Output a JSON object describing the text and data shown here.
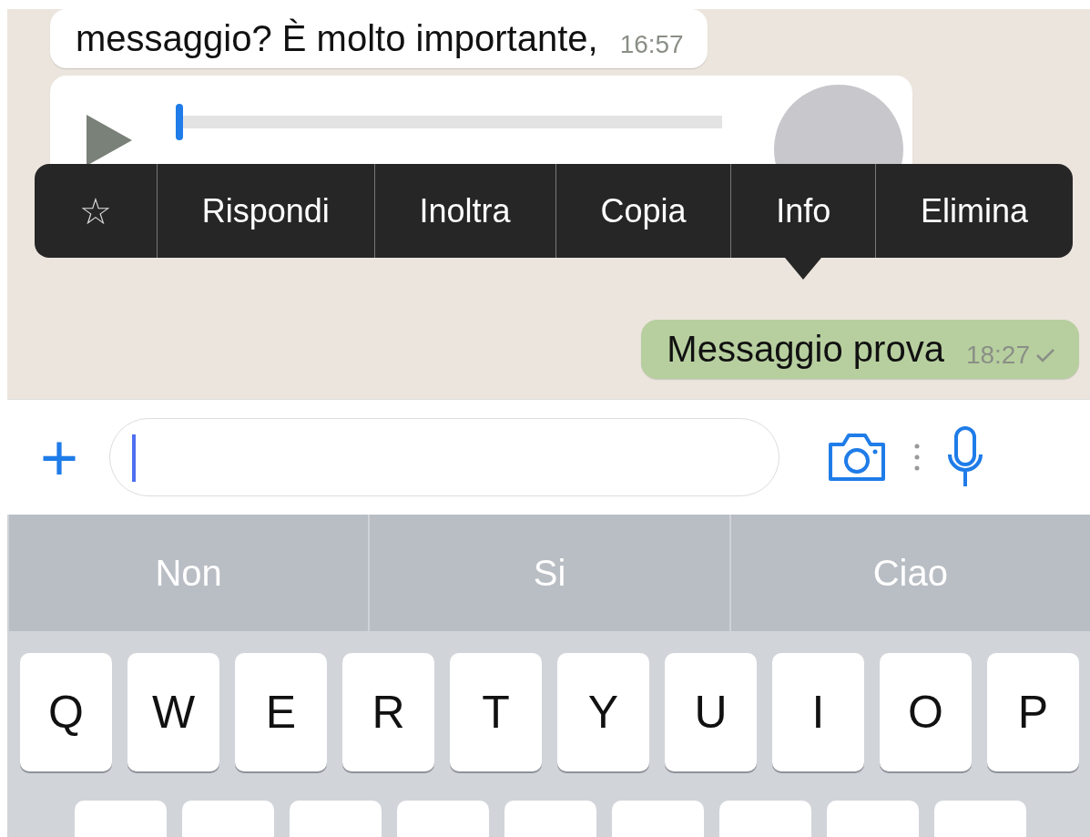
{
  "messages": [
    {
      "kind": "text",
      "outgoing": false,
      "text": "messaggio? È molto importante,",
      "time": "16:57"
    },
    {
      "kind": "audio",
      "outgoing": false,
      "level": 0
    },
    {
      "kind": "text",
      "outgoing": true,
      "text": "Messaggio prova",
      "time": "18:27",
      "sent": true
    }
  ],
  "context_menu": {
    "items": [
      {
        "kind": "icon",
        "label": "☆",
        "pointer": false
      },
      {
        "kind": "text",
        "label": "Rispondi",
        "pointer": false
      },
      {
        "kind": "text",
        "label": "Inoltra",
        "pointer": false
      },
      {
        "kind": "text",
        "label": "Copia",
        "pointer": false
      },
      {
        "kind": "text",
        "label": "Info",
        "pointer": true
      },
      {
        "kind": "text",
        "label": "Elimina",
        "pointer": false
      }
    ]
  },
  "input_bar": {
    "plus": "+"
  },
  "suggestions": [
    "Non",
    "Si",
    "Ciao"
  ],
  "keyboard": {
    "rows": [
      [
        "Q",
        "W",
        "E",
        "R",
        "T",
        "Y",
        "U",
        "I",
        "O",
        "P"
      ],
      [
        "",
        "",
        "",
        "",
        "",
        "",
        "",
        "",
        ""
      ]
    ]
  }
}
